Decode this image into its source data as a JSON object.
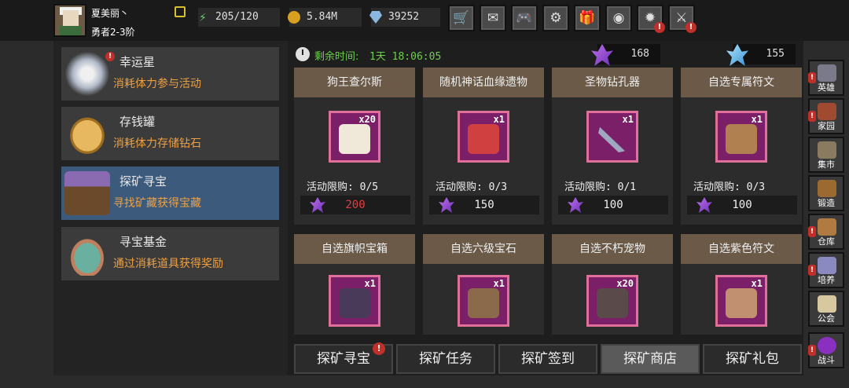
{
  "player": {
    "name": "夏美丽丶",
    "rank": "勇者2-3阶"
  },
  "resources": {
    "energy": "205/120",
    "coins": "5.84M",
    "gems": "39252"
  },
  "toolbar": [
    {
      "name": "shop-cart-icon",
      "glyph": "🛒",
      "badge": ""
    },
    {
      "name": "mail-icon",
      "glyph": "✉",
      "badge": ""
    },
    {
      "name": "gamepad-icon",
      "glyph": "🎮",
      "badge": ""
    },
    {
      "name": "gear-icon",
      "glyph": "⚙",
      "badge": ""
    },
    {
      "name": "gift-icon",
      "glyph": "🎁",
      "badge": ""
    },
    {
      "name": "wheel-icon",
      "glyph": "◉",
      "badge": ""
    },
    {
      "name": "fireworks-icon",
      "glyph": "✹",
      "badge": "!"
    },
    {
      "name": "crossed-swords-icon",
      "glyph": "⚔",
      "badge": "!"
    }
  ],
  "left_menu": [
    {
      "title": "幸运星",
      "subtitle": "消耗体力参与活动",
      "badge": "!"
    },
    {
      "title": "存钱罐",
      "subtitle": "消耗体力存储钻石",
      "badge": ""
    },
    {
      "title": "探矿寻宝",
      "subtitle": "寻找矿藏获得宝藏",
      "badge": ""
    },
    {
      "title": "寻宝基金",
      "subtitle": "通过消耗道具获得奖励",
      "badge": ""
    }
  ],
  "timer": {
    "label": "剩余时间:",
    "value": "1天 18:06:05"
  },
  "currencies": {
    "purple_crystal": "168",
    "blue_crystal": "155"
  },
  "shop_items": [
    {
      "title": "狗王查尔斯",
      "qty": "x20",
      "limit": "活动限购: 0/5",
      "price": "200",
      "price_red": true
    },
    {
      "title": "随机神话血缘遗物",
      "qty": "x1",
      "limit": "活动限购: 0/3",
      "price": "150",
      "price_red": false
    },
    {
      "title": "圣物钻孔器",
      "qty": "x1",
      "limit": "活动限购: 0/1",
      "price": "100",
      "price_red": false
    },
    {
      "title": "自选专属符文",
      "qty": "x1",
      "limit": "活动限购: 0/3",
      "price": "100",
      "price_red": false
    },
    {
      "title": "自选旗帜宝箱",
      "qty": "x1"
    },
    {
      "title": "自选六级宝石",
      "qty": "x1"
    },
    {
      "title": "自选不朽宠物",
      "qty": "x20"
    },
    {
      "title": "自选紫色符文",
      "qty": "x1"
    }
  ],
  "tabs": [
    {
      "label": "探矿寻宝",
      "badge": "!"
    },
    {
      "label": "探矿任务",
      "badge": ""
    },
    {
      "label": "探矿签到",
      "badge": ""
    },
    {
      "label": "探矿商店",
      "badge": "",
      "active": true
    },
    {
      "label": "探矿礼包",
      "badge": ""
    }
  ],
  "sidebar": [
    {
      "label": "英雄",
      "badge": "!",
      "color": "#7a7a8a"
    },
    {
      "label": "家园",
      "badge": "!",
      "color": "#a04a30"
    },
    {
      "label": "集市",
      "badge": "",
      "color": "#8a7a60"
    },
    {
      "label": "锻造",
      "badge": "",
      "color": "#9a6a30"
    },
    {
      "label": "仓库",
      "badge": "!",
      "color": "#b07a40"
    },
    {
      "label": "培养",
      "badge": "!",
      "color": "#8a8ac0"
    },
    {
      "label": "公会",
      "badge": "",
      "color": "#d8c8a0"
    },
    {
      "label": "战斗",
      "badge": "!",
      "color": "#8a30c0"
    }
  ]
}
